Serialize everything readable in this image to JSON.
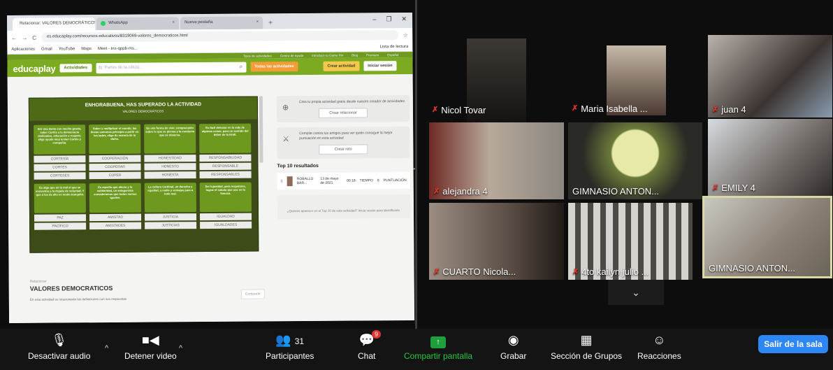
{
  "browser": {
    "tabs": [
      {
        "label": "Relacionar: VALORES DEMOCRÁTICOS",
        "active": true
      },
      {
        "label": "WhatsApp",
        "active": false
      },
      {
        "label": "Nueva pestaña",
        "active": false
      }
    ],
    "url": "es.educaplay.com/recursos-educativos/8319069-valores_democraticos.html",
    "reading_list": "Lista de lectura",
    "bookmarks": [
      "Aplicaciones",
      "Gmail",
      "YouTube",
      "Maps",
      "Meet - tnx-qppb-ms..."
    ]
  },
  "educaplay": {
    "top_links": [
      "Tipos de actividades",
      "Centro de ayuda",
      "Introduce tu Game Pin",
      "Blog",
      "Premium",
      "Español"
    ],
    "logo": "educaplay",
    "activities_btn": "Actividades",
    "search_placeholder": "Ej: Partes de la célula...",
    "btn_all": "Todas las actividades",
    "btn_create": "Crear actividad",
    "btn_login": "Iniciar sesión",
    "board": {
      "title": "ENHORABUENA, HAS SUPERADO LA ACTIVIDAD",
      "subtitle": "VALORES DEMOCRÁTICOS",
      "top_defs": [
        "Ser una dama con mucha gracia, saber Cortés a la democracia dedicados, educación y respeto, elige ayuda muy tenían Cortés y compañía.",
        "Saber y multiplicar el mundo, las líneas comunes principio a partir en los lados, elige de manera de lo dicho.",
        "Es una forma de vivir, comprensión sobre lo que se piensa y la conducta que se observa.",
        "Es fácil detectar en la vida de algunas cosas; para un sentido del deber de la kindl."
      ],
      "top_answers": [
        [
          "CORTESÍA",
          "CORTÉS",
          "CORTESES"
        ],
        [
          "COOPERACIÓN",
          "COOPERAR",
          "COPER"
        ],
        [
          "HONESTIDAD",
          "HONESTO",
          "HONESTA"
        ],
        [
          "RESPONSABILIDAD",
          "RESPONSABLE",
          "RESPONSABLES"
        ]
      ],
      "bottom_defs": [
        "Es algo que en lo mal el que se encuentra a la dejado de voluntad. Y que a los de alto en modo tranquilo.",
        "Es aquello que afecto y la solidaridad, un antagonista consideramos que todos somos iguales.",
        "La cultura Cardinal, un derecho y equidad, a nadie y ventajas para a todo mal.",
        "Ser lujosidad, para respetarse, lograr el saludo que use en la famosa."
      ],
      "bottom_answers": [
        [
          "PAZ",
          "PACÍFICO"
        ],
        [
          "AMISTAD",
          "AMISTADES"
        ],
        [
          "JUSTICIA",
          "JUSTICIAS"
        ],
        [
          "IGUALDAD",
          "IGUALDADES"
        ]
      ]
    },
    "side": {
      "create_text": "Crea tu propia actividad gratis desde nuestro creador de actividades",
      "create_btn": "Crear relacionar",
      "challenge_text": "Compite contra tus amigos para ver quién consigue la mejor puntuación en esta actividad",
      "challenge_btn": "Crear reto",
      "top10": "Top 10 resultados",
      "rank": {
        "pos": "1",
        "name": "ROBALLO BAR...",
        "date": "13 de mayo de 2021",
        "time": "00:18",
        "time_label": "TIEMPO",
        "score": "8",
        "score_label": "PUNTUACIÓN"
      },
      "notice": "¿Quieres aparecer en el Top 10 de esta actividad? Inicia sesión para identificarte."
    },
    "footer": {
      "type": "Relacionar",
      "title": "VALORES DEMOCRATICOS",
      "desc": "En esta actividad se relacionarán las definiciones con sus respuestas",
      "share": "Compartir"
    }
  },
  "participants": [
    {
      "name": "Nicol Tovar"
    },
    {
      "name": "Maria Isabella ..."
    },
    {
      "name": "juan 4"
    },
    {
      "name": "alejandra 4"
    },
    {
      "name": "GIMNASIO ANTON..."
    },
    {
      "name": "EMILY 4"
    },
    {
      "name": "CUARTO Nicola..."
    },
    {
      "name": "4to kailyn julio ..."
    },
    {
      "name": "GIMNASIO ANTON..."
    }
  ],
  "toolbar": {
    "audio": "Desactivar audio",
    "video": "Detener video",
    "participants_count": "31",
    "participants": "Participantes",
    "chat_badge": "9",
    "chat": "Chat",
    "share": "Compartir pantalla",
    "record": "Grabar",
    "breakout": "Sección de Grupos",
    "reactions": "Reacciones",
    "leave": "Salir de la sala"
  },
  "colors": {
    "edu_green": "#7cab21",
    "zoom_blue": "#2c86f4",
    "share_green": "#27c93f",
    "muted_red": "#e0342d"
  }
}
